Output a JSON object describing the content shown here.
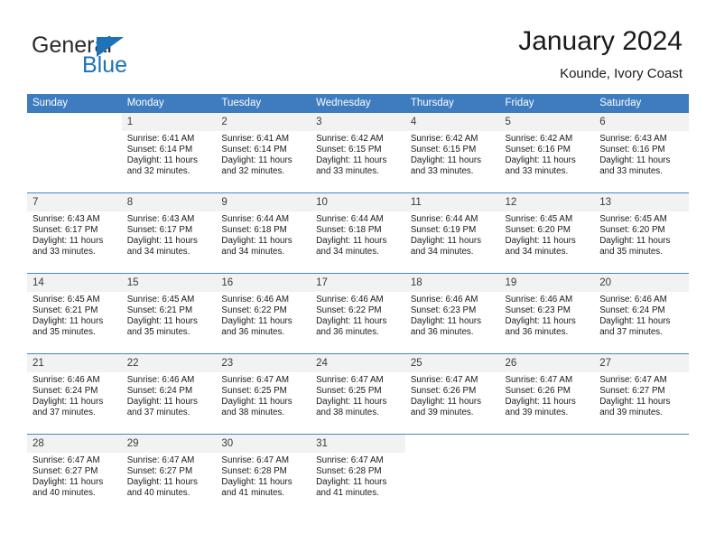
{
  "brand": {
    "name_top": "General",
    "name_bottom": "Blue",
    "triangle_icon": "brand-triangle-icon",
    "colors": {
      "blue": "#1d72b8",
      "dark": "#2b2b2b"
    }
  },
  "header": {
    "title": "January 2024",
    "subtitle": "Kounde, Ivory Coast"
  },
  "calendar": {
    "colors": {
      "header_bg": "#3e7cbf",
      "header_text": "#ffffff",
      "daynum_bg": "#f2f2f2",
      "row_divider": "#4a86c8"
    },
    "weekdays": [
      "Sunday",
      "Monday",
      "Tuesday",
      "Wednesday",
      "Thursday",
      "Friday",
      "Saturday"
    ],
    "weeks": [
      [
        {
          "day": "",
          "blank": true,
          "lines": []
        },
        {
          "day": "1",
          "lines": [
            "Sunrise: 6:41 AM",
            "Sunset: 6:14 PM",
            "Daylight: 11 hours",
            "and 32 minutes."
          ]
        },
        {
          "day": "2",
          "lines": [
            "Sunrise: 6:41 AM",
            "Sunset: 6:14 PM",
            "Daylight: 11 hours",
            "and 32 minutes."
          ]
        },
        {
          "day": "3",
          "lines": [
            "Sunrise: 6:42 AM",
            "Sunset: 6:15 PM",
            "Daylight: 11 hours",
            "and 33 minutes."
          ]
        },
        {
          "day": "4",
          "lines": [
            "Sunrise: 6:42 AM",
            "Sunset: 6:15 PM",
            "Daylight: 11 hours",
            "and 33 minutes."
          ]
        },
        {
          "day": "5",
          "lines": [
            "Sunrise: 6:42 AM",
            "Sunset: 6:16 PM",
            "Daylight: 11 hours",
            "and 33 minutes."
          ]
        },
        {
          "day": "6",
          "lines": [
            "Sunrise: 6:43 AM",
            "Sunset: 6:16 PM",
            "Daylight: 11 hours",
            "and 33 minutes."
          ]
        }
      ],
      [
        {
          "day": "7",
          "lines": [
            "Sunrise: 6:43 AM",
            "Sunset: 6:17 PM",
            "Daylight: 11 hours",
            "and 33 minutes."
          ]
        },
        {
          "day": "8",
          "lines": [
            "Sunrise: 6:43 AM",
            "Sunset: 6:17 PM",
            "Daylight: 11 hours",
            "and 34 minutes."
          ]
        },
        {
          "day": "9",
          "lines": [
            "Sunrise: 6:44 AM",
            "Sunset: 6:18 PM",
            "Daylight: 11 hours",
            "and 34 minutes."
          ]
        },
        {
          "day": "10",
          "lines": [
            "Sunrise: 6:44 AM",
            "Sunset: 6:18 PM",
            "Daylight: 11 hours",
            "and 34 minutes."
          ]
        },
        {
          "day": "11",
          "lines": [
            "Sunrise: 6:44 AM",
            "Sunset: 6:19 PM",
            "Daylight: 11 hours",
            "and 34 minutes."
          ]
        },
        {
          "day": "12",
          "lines": [
            "Sunrise: 6:45 AM",
            "Sunset: 6:20 PM",
            "Daylight: 11 hours",
            "and 34 minutes."
          ]
        },
        {
          "day": "13",
          "lines": [
            "Sunrise: 6:45 AM",
            "Sunset: 6:20 PM",
            "Daylight: 11 hours",
            "and 35 minutes."
          ]
        }
      ],
      [
        {
          "day": "14",
          "lines": [
            "Sunrise: 6:45 AM",
            "Sunset: 6:21 PM",
            "Daylight: 11 hours",
            "and 35 minutes."
          ]
        },
        {
          "day": "15",
          "lines": [
            "Sunrise: 6:45 AM",
            "Sunset: 6:21 PM",
            "Daylight: 11 hours",
            "and 35 minutes."
          ]
        },
        {
          "day": "16",
          "lines": [
            "Sunrise: 6:46 AM",
            "Sunset: 6:22 PM",
            "Daylight: 11 hours",
            "and 36 minutes."
          ]
        },
        {
          "day": "17",
          "lines": [
            "Sunrise: 6:46 AM",
            "Sunset: 6:22 PM",
            "Daylight: 11 hours",
            "and 36 minutes."
          ]
        },
        {
          "day": "18",
          "lines": [
            "Sunrise: 6:46 AM",
            "Sunset: 6:23 PM",
            "Daylight: 11 hours",
            "and 36 minutes."
          ]
        },
        {
          "day": "19",
          "lines": [
            "Sunrise: 6:46 AM",
            "Sunset: 6:23 PM",
            "Daylight: 11 hours",
            "and 36 minutes."
          ]
        },
        {
          "day": "20",
          "lines": [
            "Sunrise: 6:46 AM",
            "Sunset: 6:24 PM",
            "Daylight: 11 hours",
            "and 37 minutes."
          ]
        }
      ],
      [
        {
          "day": "21",
          "lines": [
            "Sunrise: 6:46 AM",
            "Sunset: 6:24 PM",
            "Daylight: 11 hours",
            "and 37 minutes."
          ]
        },
        {
          "day": "22",
          "lines": [
            "Sunrise: 6:46 AM",
            "Sunset: 6:24 PM",
            "Daylight: 11 hours",
            "and 37 minutes."
          ]
        },
        {
          "day": "23",
          "lines": [
            "Sunrise: 6:47 AM",
            "Sunset: 6:25 PM",
            "Daylight: 11 hours",
            "and 38 minutes."
          ]
        },
        {
          "day": "24",
          "lines": [
            "Sunrise: 6:47 AM",
            "Sunset: 6:25 PM",
            "Daylight: 11 hours",
            "and 38 minutes."
          ]
        },
        {
          "day": "25",
          "lines": [
            "Sunrise: 6:47 AM",
            "Sunset: 6:26 PM",
            "Daylight: 11 hours",
            "and 39 minutes."
          ]
        },
        {
          "day": "26",
          "lines": [
            "Sunrise: 6:47 AM",
            "Sunset: 6:26 PM",
            "Daylight: 11 hours",
            "and 39 minutes."
          ]
        },
        {
          "day": "27",
          "lines": [
            "Sunrise: 6:47 AM",
            "Sunset: 6:27 PM",
            "Daylight: 11 hours",
            "and 39 minutes."
          ]
        }
      ],
      [
        {
          "day": "28",
          "lines": [
            "Sunrise: 6:47 AM",
            "Sunset: 6:27 PM",
            "Daylight: 11 hours",
            "and 40 minutes."
          ]
        },
        {
          "day": "29",
          "lines": [
            "Sunrise: 6:47 AM",
            "Sunset: 6:27 PM",
            "Daylight: 11 hours",
            "and 40 minutes."
          ]
        },
        {
          "day": "30",
          "lines": [
            "Sunrise: 6:47 AM",
            "Sunset: 6:28 PM",
            "Daylight: 11 hours",
            "and 41 minutes."
          ]
        },
        {
          "day": "31",
          "lines": [
            "Sunrise: 6:47 AM",
            "Sunset: 6:28 PM",
            "Daylight: 11 hours",
            "and 41 minutes."
          ]
        },
        {
          "day": "",
          "blank": true,
          "lines": []
        },
        {
          "day": "",
          "blank": true,
          "lines": []
        },
        {
          "day": "",
          "blank": true,
          "lines": []
        }
      ]
    ]
  }
}
